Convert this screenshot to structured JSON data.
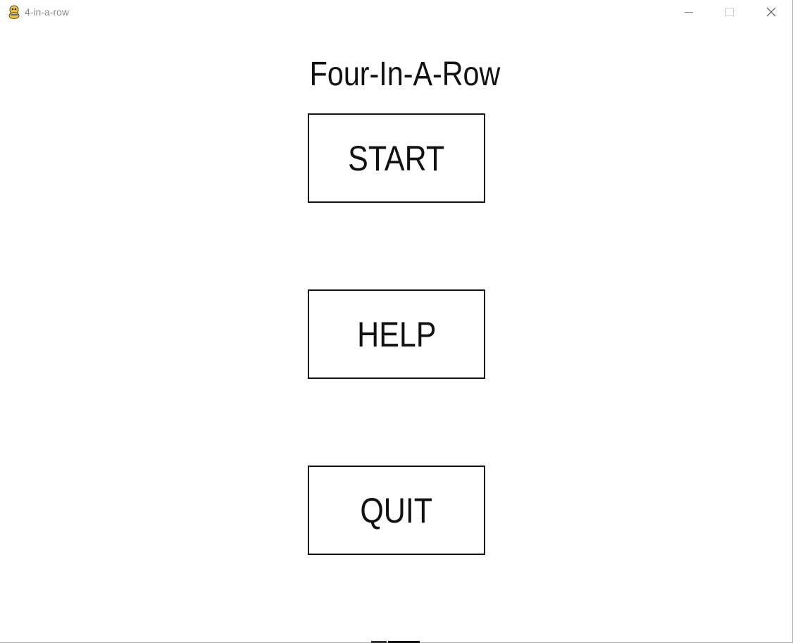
{
  "window": {
    "title": "4-in-a-row",
    "icon": "pygame-snake-icon",
    "controls": {
      "minimize": "minimize-icon",
      "maximize": "maximize-icon",
      "close": "close-icon"
    }
  },
  "menu": {
    "title": "Four-In-A-Row",
    "buttons": {
      "start": "START",
      "help": "HELP",
      "quit": "QUIT"
    }
  },
  "colors": {
    "background": "#ffffff",
    "text": "#111111",
    "border": "#111111"
  }
}
